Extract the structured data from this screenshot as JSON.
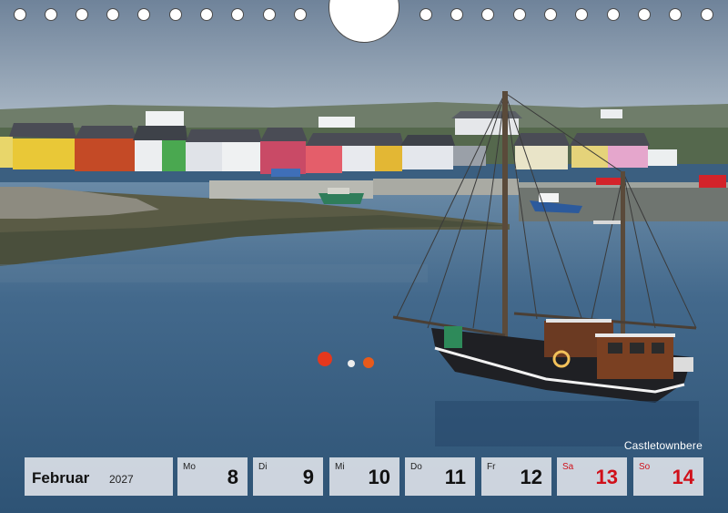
{
  "photo": {
    "location": "Castletownbere"
  },
  "calendar": {
    "month": "Februar",
    "year": "2027",
    "days": [
      {
        "dow": "Mo",
        "num": "8"
      },
      {
        "dow": "Di",
        "num": "9"
      },
      {
        "dow": "Mi",
        "num": "10"
      },
      {
        "dow": "Do",
        "num": "11"
      },
      {
        "dow": "Fr",
        "num": "12"
      },
      {
        "dow": "Sa",
        "num": "13"
      },
      {
        "dow": "So",
        "num": "14"
      }
    ]
  },
  "colors": {
    "weekend": "#d0101a",
    "strip_background": "#e2e6ec",
    "water": "#3b5f80",
    "sky": "#8a9db0"
  }
}
